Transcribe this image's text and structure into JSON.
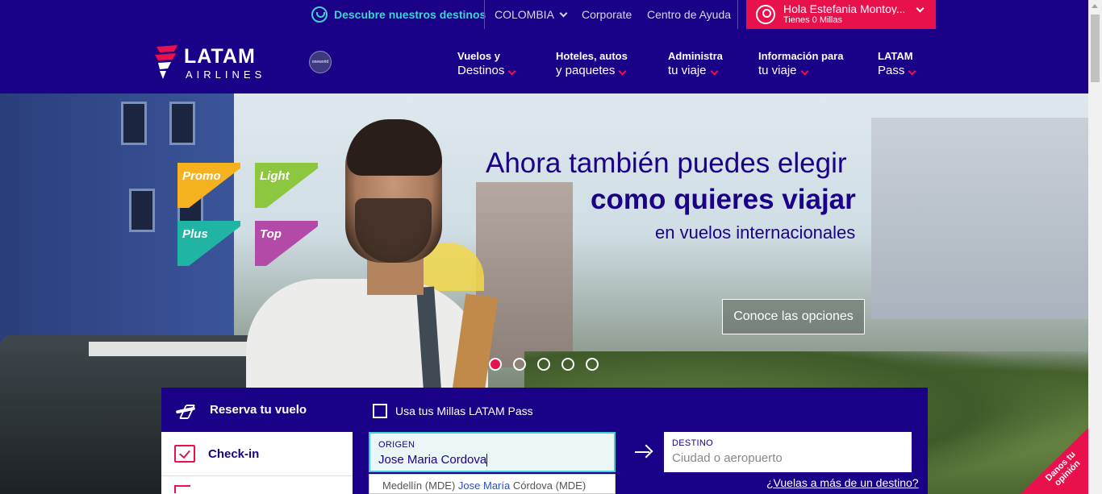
{
  "topbar": {
    "discover": "Descubre nuestros destinos",
    "country": "COLOMBIA",
    "corporate": "Corporate",
    "help": "Centro de Ayuda",
    "user_greeting": "Hola Estefania Montoy...",
    "user_miles": "Tienes 0 Millas"
  },
  "logo": {
    "name": "LATAM",
    "sub": "AIRLINES",
    "alliance": "oneworld"
  },
  "nav": [
    {
      "line1": "Vuelos y",
      "line2": "Destinos"
    },
    {
      "line1": "Hoteles, autos",
      "line2": "y paquetes"
    },
    {
      "line1": "Administra",
      "line2": "tu viaje"
    },
    {
      "line1": "Información para",
      "line2": "tu viaje"
    },
    {
      "line1": "LATAM",
      "line2": "Pass"
    }
  ],
  "hero": {
    "tags": [
      "Promo",
      "Light",
      "Plus",
      "Top"
    ],
    "headline1": "Ahora también puedes elegir",
    "headline2": "como quieres viajar",
    "headline3": "en vuelos internacionales",
    "cta": "Conoce las opciones",
    "slides": 5,
    "active_slide": 1
  },
  "booking": {
    "tab_book": "Reserva tu vuelo",
    "tab_checkin": "Check-in",
    "miles_option": "Usa tus Millas LATAM Pass",
    "origin_label": "ORIGEN",
    "origin_value": "Jose Maria Cordova",
    "dest_label": "DESTINO",
    "dest_placeholder": "Ciudad o aeropuerto",
    "suggestion_prefix": "Medellín (MDE)",
    "suggestion_match": "Jose María",
    "suggestion_rest": "Córdova (MDE)",
    "multi_destination": "¿Vuelas a más de un destino?"
  },
  "feedback": {
    "line1": "Danos tu",
    "line2": "opinión"
  },
  "colors": {
    "brand": "#1b0088",
    "accent": "#e8114b",
    "teal": "#3fd1d4"
  }
}
